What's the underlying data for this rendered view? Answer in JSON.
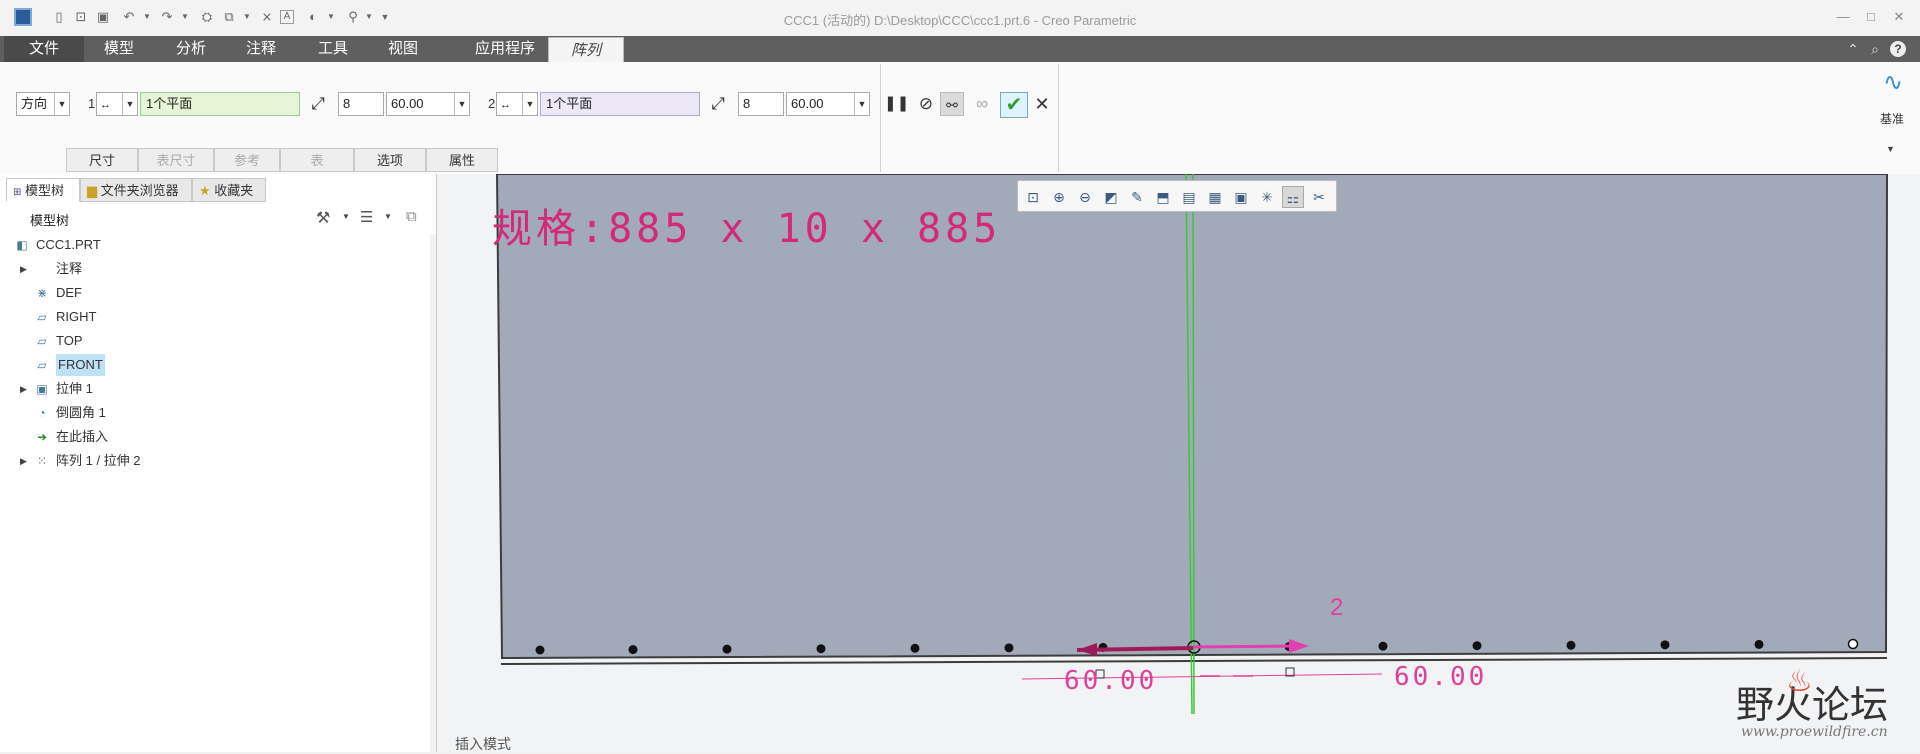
{
  "window": {
    "title": "CCC1 (活动的) D:\\Desktop\\CCC\\ccc1.prt.6 - Creo Parametric",
    "quick_access_icons": [
      "app-icon",
      "new-icon",
      "open-icon",
      "save-icon",
      "undo-icon",
      "redo-icon",
      "regenerate-icon",
      "window-icon",
      "close-window-icon",
      "text-icon",
      "appearance-icon",
      "pin-icon",
      "customize-icon"
    ],
    "controls": {
      "minimize": "—",
      "maximize": "□",
      "close": "✕"
    }
  },
  "menu": {
    "tabs": [
      "文件",
      "模型",
      "分析",
      "注释",
      "工具",
      "视图",
      "应用程序",
      "阵列"
    ],
    "active_tab": "阵列",
    "right_icons": [
      "collapse-ribbon-icon",
      "search-icon",
      "help-icon"
    ]
  },
  "ribbon": {
    "type_select": "方向",
    "dir1": {
      "number": "1",
      "reference": "1个平面",
      "count": "8",
      "spacing": "60.00"
    },
    "dir2": {
      "number": "2",
      "reference": "1个平面",
      "count": "8",
      "spacing": "60.00"
    },
    "subtabs": [
      {
        "label": "尺寸",
        "enabled": true
      },
      {
        "label": "表尺寸",
        "enabled": false
      },
      {
        "label": "参考",
        "enabled": false
      },
      {
        "label": "表",
        "enabled": false
      },
      {
        "label": "选项",
        "enabled": true
      },
      {
        "label": "属性",
        "enabled": true
      }
    ],
    "datum_label": "基准"
  },
  "panel": {
    "tabs": [
      "模型树",
      "文件夹浏览器",
      "收藏夹"
    ],
    "header": "模型树",
    "tree": [
      {
        "label": "CCC1.PRT",
        "icon": "part-icon",
        "expandable": false,
        "indent": 0
      },
      {
        "label": "注释",
        "icon": "",
        "expandable": true,
        "indent": 1
      },
      {
        "label": "DEF",
        "icon": "csys-icon",
        "expandable": false,
        "indent": 1
      },
      {
        "label": "RIGHT",
        "icon": "datum-plane-icon",
        "expandable": false,
        "indent": 1
      },
      {
        "label": "TOP",
        "icon": "datum-plane-icon",
        "expandable": false,
        "indent": 1
      },
      {
        "label": "FRONT",
        "icon": "datum-plane-icon",
        "expandable": false,
        "indent": 1,
        "selected": true
      },
      {
        "label": "拉伸 1",
        "icon": "extrude-icon",
        "expandable": true,
        "indent": 1
      },
      {
        "label": "倒圆角 1",
        "icon": "round-icon",
        "expandable": false,
        "indent": 1
      },
      {
        "label": "在此插入",
        "icon": "insert-arrow-icon",
        "expandable": false,
        "indent": 1
      },
      {
        "label": "阵列 1 / 拉伸 2",
        "icon": "pattern-icon",
        "expandable": true,
        "indent": 1
      }
    ]
  },
  "graphics": {
    "annotation": "规格:885 x 10 x 885",
    "dim_left": "60.00",
    "dim_right": "60.00",
    "dir_label": "2",
    "status": "插入模式",
    "watermark_title": "野火论坛",
    "watermark_url": "www.proewildfire.cn"
  },
  "colors": {
    "model_face": "#a2aab9",
    "annotation": "#d4287a",
    "dimension": "#e0409a",
    "datum_green": "#3cc43c",
    "tab_bar": "#5f5f5f",
    "confirm_green": "#3db23d"
  }
}
